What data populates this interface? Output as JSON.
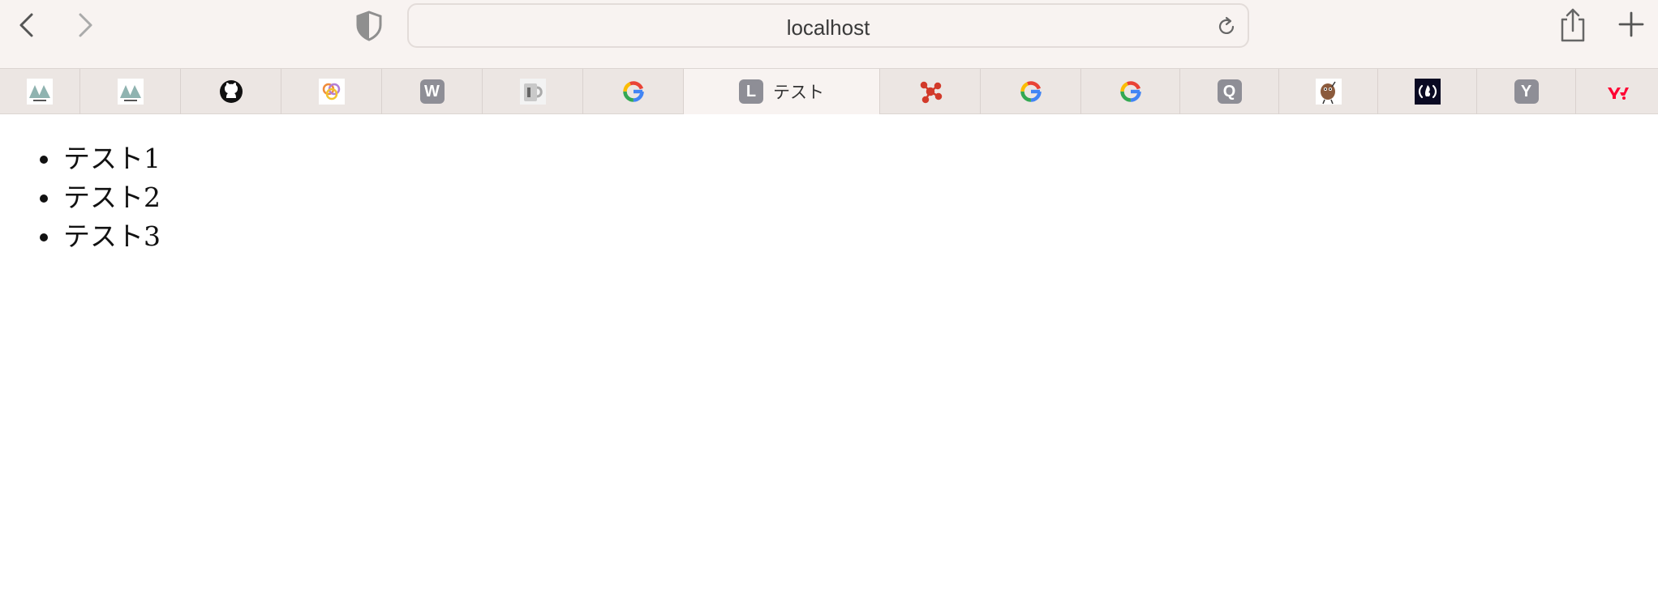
{
  "browser": {
    "url": "localhost",
    "icons": {
      "back": "chevron-left-icon",
      "forward": "chevron-right-icon",
      "privacy": "shield-icon",
      "reload": "reload-icon",
      "share": "share-icon",
      "new_tab": "plus-icon"
    }
  },
  "tabs": [
    {
      "icon": "mountain-logo-icon",
      "letter": ""
    },
    {
      "icon": "mountain-logo-icon",
      "letter": ""
    },
    {
      "icon": "github-icon",
      "letter": ""
    },
    {
      "icon": "colorful-swirl-icon",
      "letter": ""
    },
    {
      "icon": "letter-icon",
      "letter": "W"
    },
    {
      "icon": "mug-icon",
      "letter": ""
    },
    {
      "icon": "google-icon",
      "letter": ""
    },
    {
      "icon": "letter-icon",
      "letter": "L",
      "title": "テスト",
      "active": true
    },
    {
      "icon": "red-molecule-icon",
      "letter": ""
    },
    {
      "icon": "google-icon",
      "letter": ""
    },
    {
      "icon": "google-icon",
      "letter": ""
    },
    {
      "icon": "letter-icon",
      "letter": "Q"
    },
    {
      "icon": "character-icon",
      "letter": ""
    },
    {
      "icon": "freecodecamp-icon",
      "letter": ""
    },
    {
      "icon": "letter-icon",
      "letter": "Y"
    },
    {
      "icon": "yahoo-icon",
      "letter": ""
    }
  ],
  "content": {
    "items": [
      "テスト1",
      "テスト2",
      "テスト3"
    ]
  },
  "colors": {
    "toolbar_bg": "#f8f3f1",
    "tabbar_bg": "#ece6e3",
    "letter_favicon_bg": "#8e8e96"
  }
}
